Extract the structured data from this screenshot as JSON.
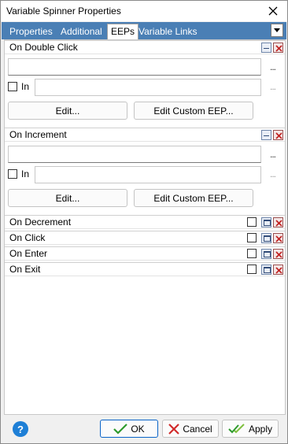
{
  "window": {
    "title": "Variable Spinner Properties"
  },
  "tabs": [
    {
      "label": "Properties"
    },
    {
      "label": "Additional"
    },
    {
      "label": "EEPs"
    },
    {
      "label": "Variable Links"
    }
  ],
  "active_tab": "EEPs",
  "sections": {
    "double_click": {
      "title": "On Double Click",
      "ellipsis": "...",
      "in_label": "In",
      "in_ellipsis": "...",
      "edit_label": "Edit...",
      "custom_label": "Edit Custom EEP..."
    },
    "increment": {
      "title": "On Increment",
      "ellipsis": "...",
      "in_label": "In",
      "in_ellipsis": "...",
      "edit_label": "Edit...",
      "custom_label": "Edit Custom EEP..."
    },
    "collapsed": [
      {
        "title": "On Decrement"
      },
      {
        "title": "On Click"
      },
      {
        "title": "On Enter"
      },
      {
        "title": "On Exit"
      }
    ]
  },
  "footer": {
    "help": "?",
    "ok_label": "OK",
    "cancel_label": "Cancel",
    "apply_label": "Apply"
  },
  "colors": {
    "tab_strip": "#4a7fb5",
    "help_icon": "#1e7fd6",
    "ok_check": "#2e9b2e",
    "cancel_x": "#d12b2b"
  }
}
